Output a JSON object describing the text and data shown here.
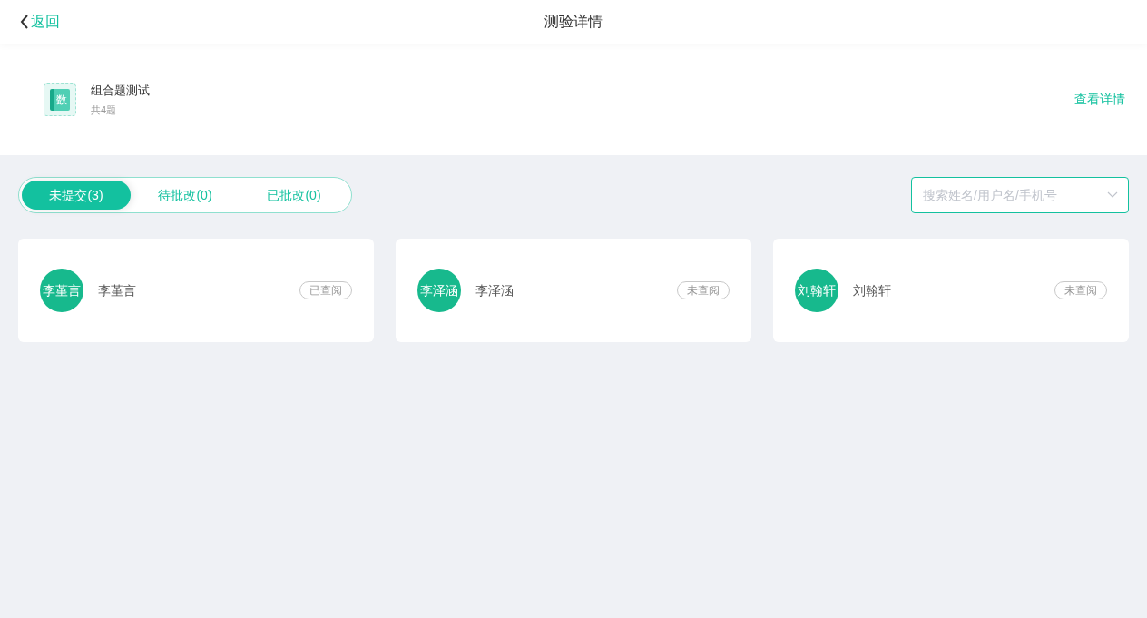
{
  "header": {
    "back": "返回",
    "title": "测验详情"
  },
  "quiz": {
    "icon_text": "数",
    "title": "组合题测试",
    "count": "共4题",
    "details_link": "查看详情"
  },
  "tabs": [
    {
      "label": "未提交(3)",
      "selected": true
    },
    {
      "label": "待批改(0)",
      "selected": false
    },
    {
      "label": "已批改(0)",
      "selected": false
    }
  ],
  "search": {
    "placeholder": "搜索姓名/用户名/手机号"
  },
  "students": [
    {
      "avatar": "李堇言",
      "name": "李堇言",
      "status": "已查阅"
    },
    {
      "avatar": "李泽涵",
      "name": "李泽涵",
      "status": "未查阅"
    },
    {
      "avatar": "刘翰轩",
      "name": "刘翰轩",
      "status": "未查阅"
    }
  ]
}
